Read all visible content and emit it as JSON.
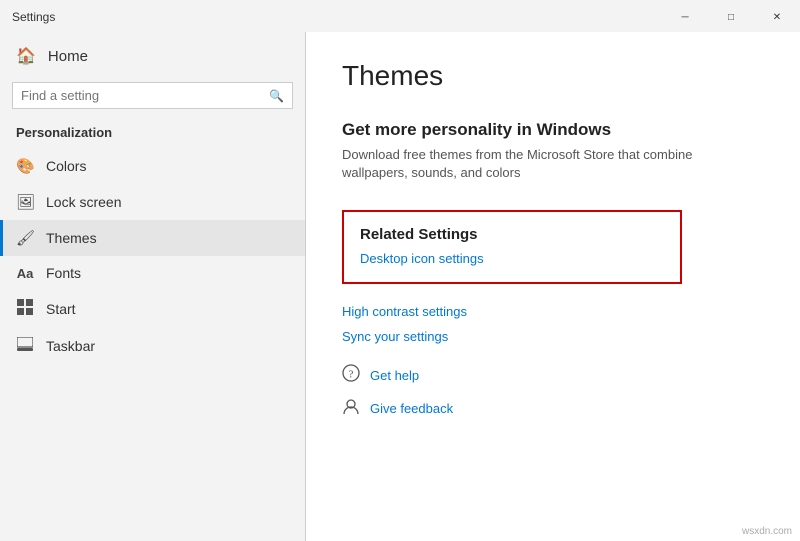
{
  "titlebar": {
    "title": "Settings",
    "minimize_label": "─",
    "maximize_label": "□",
    "close_label": "✕"
  },
  "sidebar": {
    "home_label": "Home",
    "search_placeholder": "Find a setting",
    "section_label": "Personalization",
    "items": [
      {
        "id": "colors",
        "label": "Colors",
        "icon": "🎨"
      },
      {
        "id": "lock-screen",
        "label": "Lock screen",
        "icon": "🖼"
      },
      {
        "id": "themes",
        "label": "Themes",
        "icon": "🖌",
        "active": true
      },
      {
        "id": "fonts",
        "label": "Fonts",
        "icon": "Aa"
      },
      {
        "id": "start",
        "label": "Start",
        "icon": "⊞"
      },
      {
        "id": "taskbar",
        "label": "Taskbar",
        "icon": "▬"
      }
    ]
  },
  "main": {
    "title": "Themes",
    "personality_heading": "Get more personality in Windows",
    "personality_desc": "Download free themes from the Microsoft Store that combine wallpapers, sounds, and colors",
    "related_settings": {
      "heading": "Related Settings",
      "links": [
        {
          "id": "desktop-icon-settings",
          "label": "Desktop icon settings"
        }
      ]
    },
    "standalone_links": [
      {
        "id": "high-contrast",
        "label": "High contrast settings"
      },
      {
        "id": "sync-settings",
        "label": "Sync your settings"
      }
    ],
    "help_items": [
      {
        "id": "get-help",
        "label": "Get help",
        "icon": "💬"
      },
      {
        "id": "give-feedback",
        "label": "Give feedback",
        "icon": "👤"
      }
    ]
  },
  "watermark": "wsxdn.com"
}
